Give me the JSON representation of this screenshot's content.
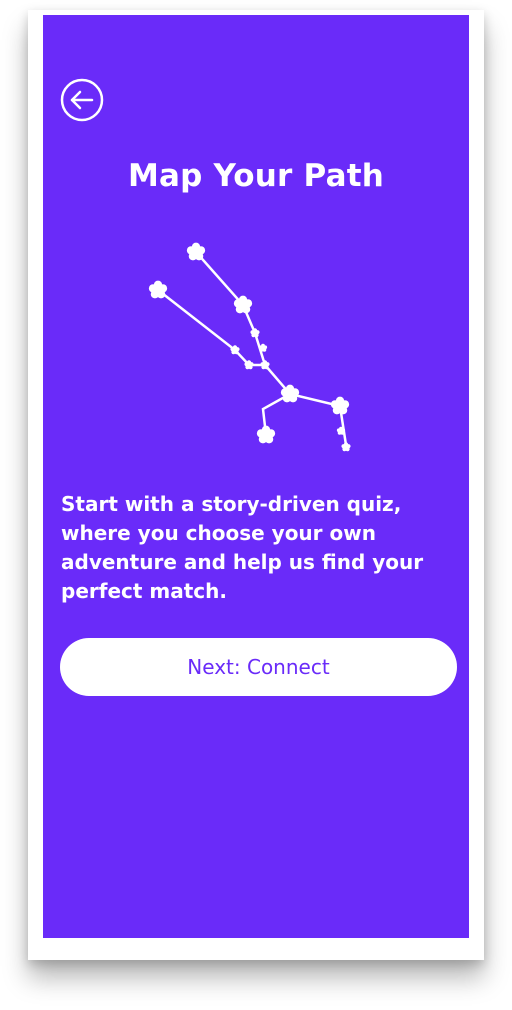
{
  "screen": {
    "title": "Map Your Path",
    "description": "Start with a story-driven quiz, where you choose your own adventure and help us find your perfect match.",
    "primary_button_label": "Next: Connect",
    "back_icon": "arrow-left-circle-icon",
    "illustration_icon": "constellation-icon"
  },
  "colors": {
    "background": "#6a2bf9",
    "text": "#ffffff",
    "button_bg": "#ffffff",
    "button_text": "#6a2bf9"
  }
}
